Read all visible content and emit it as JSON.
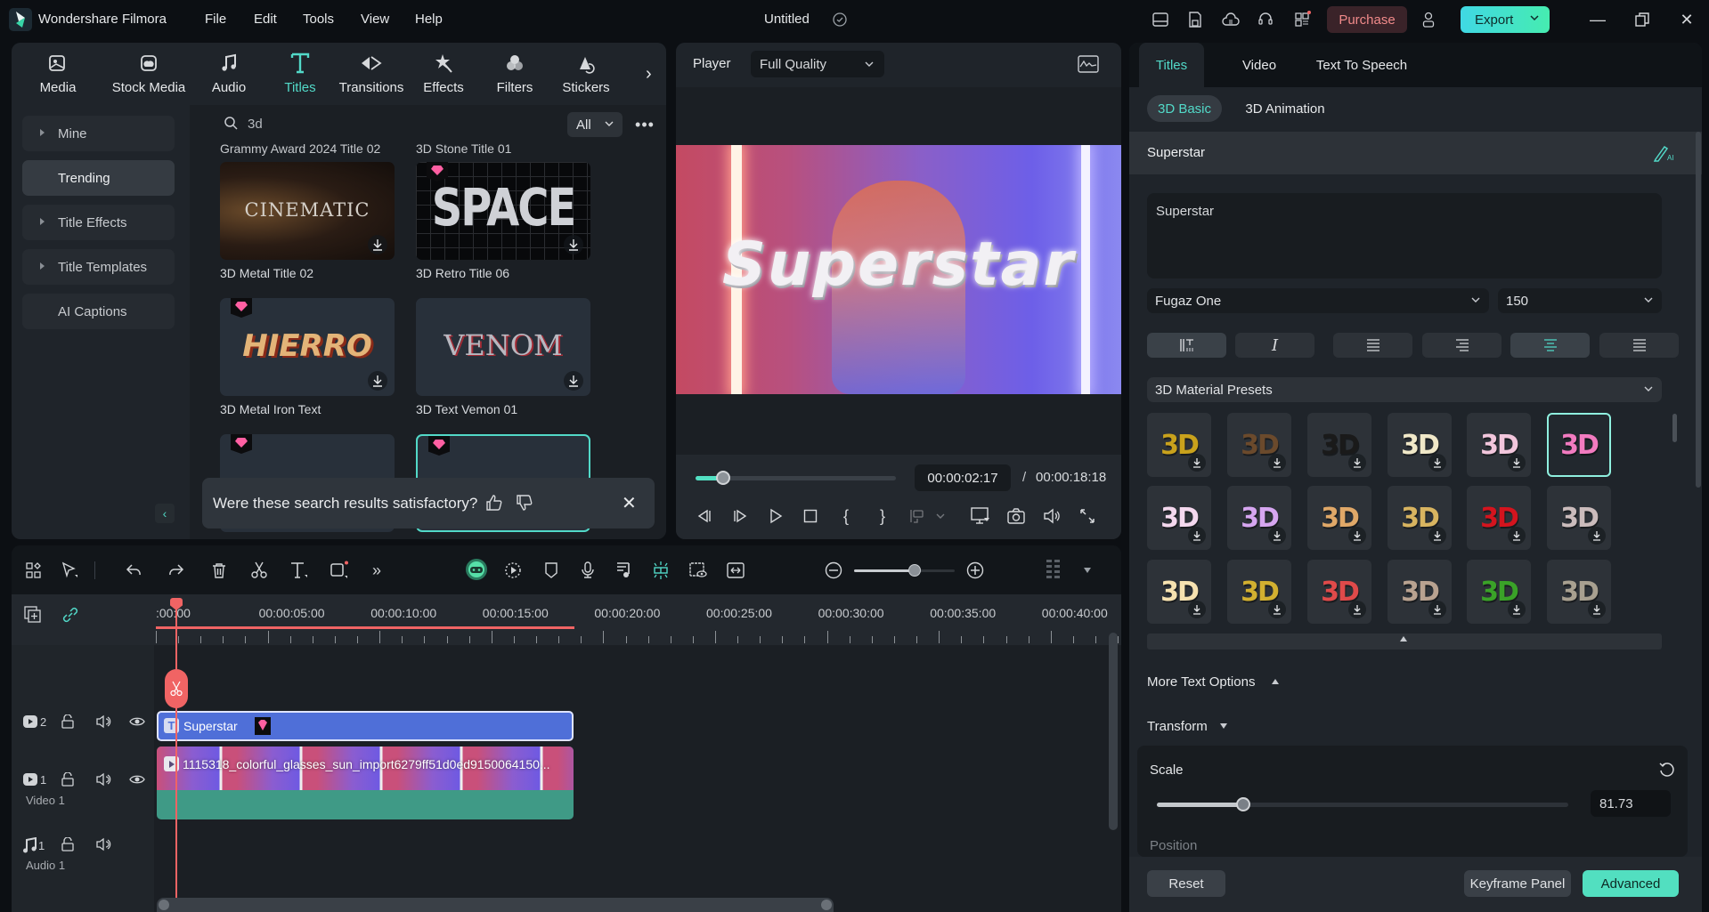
{
  "titlebar": {
    "app_name": "Wondershare Filmora",
    "menu": [
      "File",
      "Edit",
      "Tools",
      "View",
      "Help"
    ],
    "document_title": "Untitled",
    "purchase_label": "Purchase",
    "export_label": "Export"
  },
  "media_tabs": [
    {
      "label": "Media",
      "icon": "media-icon"
    },
    {
      "label": "Stock Media",
      "icon": "stock-media-icon"
    },
    {
      "label": "Audio",
      "icon": "audio-icon"
    },
    {
      "label": "Titles",
      "icon": "titles-icon",
      "active": true
    },
    {
      "label": "Transitions",
      "icon": "transitions-icon"
    },
    {
      "label": "Effects",
      "icon": "effects-icon"
    },
    {
      "label": "Filters",
      "icon": "filters-icon"
    },
    {
      "label": "Stickers",
      "icon": "stickers-icon"
    }
  ],
  "sidebar": {
    "items": [
      {
        "label": "Mine",
        "expandable": true
      },
      {
        "label": "Trending",
        "active": true
      },
      {
        "label": "Title Effects",
        "expandable": true
      },
      {
        "label": "Title Templates",
        "expandable": true
      },
      {
        "label": "AI Captions"
      }
    ]
  },
  "search": {
    "query": "3d",
    "filter": "All"
  },
  "results": {
    "cut_labels": [
      "Grammy Award 2024 Title 02",
      "3D Stone Title 01"
    ],
    "items": [
      {
        "label": "3D Metal Title 02",
        "preview_text": "CINEMATIC",
        "premium": false
      },
      {
        "label": "3D Retro Title 06",
        "preview_text": "SPACE",
        "premium": true
      },
      {
        "label": "3D Metal Iron Text",
        "preview_text": "HIERRO",
        "premium": true
      },
      {
        "label": "3D Text Vemon 01",
        "preview_text": "VENOM",
        "premium": false
      },
      {
        "label": "",
        "preview_text": "",
        "premium": true
      },
      {
        "label": "",
        "preview_text": "",
        "premium": true,
        "selected": true
      }
    ],
    "feedback_question": "Were these search results satisfactory?"
  },
  "player": {
    "label": "Player",
    "quality": "Full Quality",
    "overlay_text": "Superstar",
    "current_time": "00:00:02:17",
    "separator": "/",
    "total_time": "00:00:18:18",
    "progress": 0.136
  },
  "right_panel": {
    "tabs": [
      {
        "label": "Titles",
        "active": true
      },
      {
        "label": "Video"
      },
      {
        "label": "Text To Speech"
      }
    ],
    "subtabs": [
      {
        "label": "3D Basic",
        "active": true
      },
      {
        "label": "3D Animation"
      }
    ],
    "section_title": "Superstar",
    "text_value": "Superstar",
    "font": "Fugaz One",
    "font_size": "150",
    "material_presets_label": "3D Material Presets",
    "presets": [
      {
        "text": "3D",
        "color": "#c9a21c"
      },
      {
        "text": "3D",
        "color": "#6b4a2c"
      },
      {
        "text": "3D",
        "color": "#1a1a1a"
      },
      {
        "text": "3D",
        "color": "#f0e8c8"
      },
      {
        "text": "3D",
        "color": "#f2c6dc"
      },
      {
        "text": "3D",
        "color": "#f27bc0",
        "selected": true
      },
      {
        "text": "3D",
        "color": "#f4d8ee"
      },
      {
        "text": "3D",
        "color": "#d6a6f0"
      },
      {
        "text": "3D",
        "color": "#e0a868"
      },
      {
        "text": "3D",
        "color": "#d8b460"
      },
      {
        "text": "3D",
        "color": "#d4141e"
      },
      {
        "text": "3D",
        "color": "#cbbcbc"
      },
      {
        "text": "3D",
        "color": "#f6e2b0"
      },
      {
        "text": "3D",
        "color": "#d2b030"
      },
      {
        "text": "3D",
        "color": "#e04a4a"
      },
      {
        "text": "3D",
        "color": "#b8a290"
      },
      {
        "text": "3D",
        "color": "#3aa228"
      },
      {
        "text": "3D",
        "color": "#a8a090"
      }
    ],
    "more_text_options": "More Text Options",
    "transform_label": "Transform",
    "scale_label": "Scale",
    "scale_value": "81.73",
    "scale_fraction": 0.21,
    "position_label": "Position",
    "reset_label": "Reset",
    "keyframe_label": "Keyframe Panel",
    "advanced_label": "Advanced"
  },
  "timeline": {
    "ruler_labels": [
      ":00:00",
      "00:00:05:00",
      "00:00:10:00",
      "00:00:15:00",
      "00:00:20:00",
      "00:00:25:00",
      "00:00:30:00",
      "00:00:35:00",
      "00:00:40:00"
    ],
    "zoom_level": 0.6,
    "tracks": [
      {
        "index": "2",
        "type": "video",
        "name": ""
      },
      {
        "index": "1",
        "type": "video",
        "name": "Video 1"
      },
      {
        "index": "1",
        "type": "audio",
        "name": "Audio 1"
      }
    ],
    "title_clip": "Superstar",
    "video_clip": "1115318_colorful_glasses_sun_import6279ff51d0ed9150064150..."
  },
  "colors": {
    "accent": "#52d9c8",
    "playhead": "#f06464",
    "title_clip": "#4f6fd8",
    "video_audio_strip": "#3f9a86"
  }
}
